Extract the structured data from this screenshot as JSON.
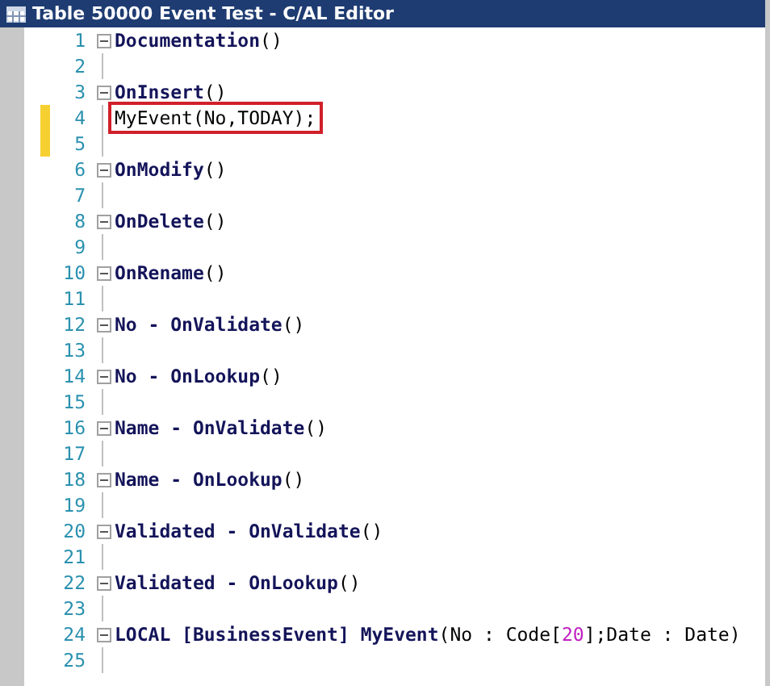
{
  "window": {
    "title": "Table 50000 Event Test - C/AL Editor"
  },
  "lines": [
    {
      "number": "1",
      "fold": true,
      "changed": false,
      "highlighted": false,
      "tokens": [
        {
          "text": "Documentation",
          "kind": "keyword"
        },
        {
          "text": "()",
          "kind": "plain"
        }
      ]
    },
    {
      "number": "2",
      "fold": false,
      "changed": false,
      "highlighted": false
    },
    {
      "number": "3",
      "fold": true,
      "changed": false,
      "highlighted": false,
      "tokens": [
        {
          "text": "OnInsert",
          "kind": "keyword"
        },
        {
          "text": "()",
          "kind": "plain"
        }
      ]
    },
    {
      "number": "4",
      "fold": false,
      "changed": true,
      "highlighted": true,
      "tokens": [
        {
          "text": "MyEvent(No,TODAY);",
          "kind": "plain"
        }
      ]
    },
    {
      "number": "5",
      "fold": false,
      "changed": true,
      "highlighted": false
    },
    {
      "number": "6",
      "fold": true,
      "changed": false,
      "highlighted": false,
      "tokens": [
        {
          "text": "OnModify",
          "kind": "keyword"
        },
        {
          "text": "()",
          "kind": "plain"
        }
      ]
    },
    {
      "number": "7",
      "fold": false,
      "changed": false,
      "highlighted": false
    },
    {
      "number": "8",
      "fold": true,
      "changed": false,
      "highlighted": false,
      "tokens": [
        {
          "text": "OnDelete",
          "kind": "keyword"
        },
        {
          "text": "()",
          "kind": "plain"
        }
      ]
    },
    {
      "number": "9",
      "fold": false,
      "changed": false,
      "highlighted": false
    },
    {
      "number": "10",
      "fold": true,
      "changed": false,
      "highlighted": false,
      "tokens": [
        {
          "text": "OnRename",
          "kind": "keyword"
        },
        {
          "text": "()",
          "kind": "plain"
        }
      ]
    },
    {
      "number": "11",
      "fold": false,
      "changed": false,
      "highlighted": false
    },
    {
      "number": "12",
      "fold": true,
      "changed": false,
      "highlighted": false,
      "tokens": [
        {
          "text": "No - OnValidate",
          "kind": "keyword"
        },
        {
          "text": "()",
          "kind": "plain"
        }
      ]
    },
    {
      "number": "13",
      "fold": false,
      "changed": false,
      "highlighted": false
    },
    {
      "number": "14",
      "fold": true,
      "changed": false,
      "highlighted": false,
      "tokens": [
        {
          "text": "No - OnLookup",
          "kind": "keyword"
        },
        {
          "text": "()",
          "kind": "plain"
        }
      ]
    },
    {
      "number": "15",
      "fold": false,
      "changed": false,
      "highlighted": false
    },
    {
      "number": "16",
      "fold": true,
      "changed": false,
      "highlighted": false,
      "tokens": [
        {
          "text": "Name - OnValidate",
          "kind": "keyword"
        },
        {
          "text": "()",
          "kind": "plain"
        }
      ]
    },
    {
      "number": "17",
      "fold": false,
      "changed": false,
      "highlighted": false
    },
    {
      "number": "18",
      "fold": true,
      "changed": false,
      "highlighted": false,
      "tokens": [
        {
          "text": "Name - OnLookup",
          "kind": "keyword"
        },
        {
          "text": "()",
          "kind": "plain"
        }
      ]
    },
    {
      "number": "19",
      "fold": false,
      "changed": false,
      "highlighted": false
    },
    {
      "number": "20",
      "fold": true,
      "changed": false,
      "highlighted": false,
      "tokens": [
        {
          "text": "Validated - OnValidate",
          "kind": "keyword"
        },
        {
          "text": "()",
          "kind": "plain"
        }
      ]
    },
    {
      "number": "21",
      "fold": false,
      "changed": false,
      "highlighted": false
    },
    {
      "number": "22",
      "fold": true,
      "changed": false,
      "highlighted": false,
      "tokens": [
        {
          "text": "Validated - OnLookup",
          "kind": "keyword"
        },
        {
          "text": "()",
          "kind": "plain"
        }
      ]
    },
    {
      "number": "23",
      "fold": false,
      "changed": false,
      "highlighted": false
    },
    {
      "number": "24",
      "fold": true,
      "changed": false,
      "highlighted": false,
      "tokens": [
        {
          "text": "LOCAL [BusinessEvent] MyEvent",
          "kind": "keyword"
        },
        {
          "text": "(No : Code[",
          "kind": "plain"
        },
        {
          "text": "20",
          "kind": "number"
        },
        {
          "text": "];Date : Date)",
          "kind": "plain"
        }
      ]
    },
    {
      "number": "25",
      "fold": false,
      "changed": false,
      "highlighted": false
    }
  ]
}
